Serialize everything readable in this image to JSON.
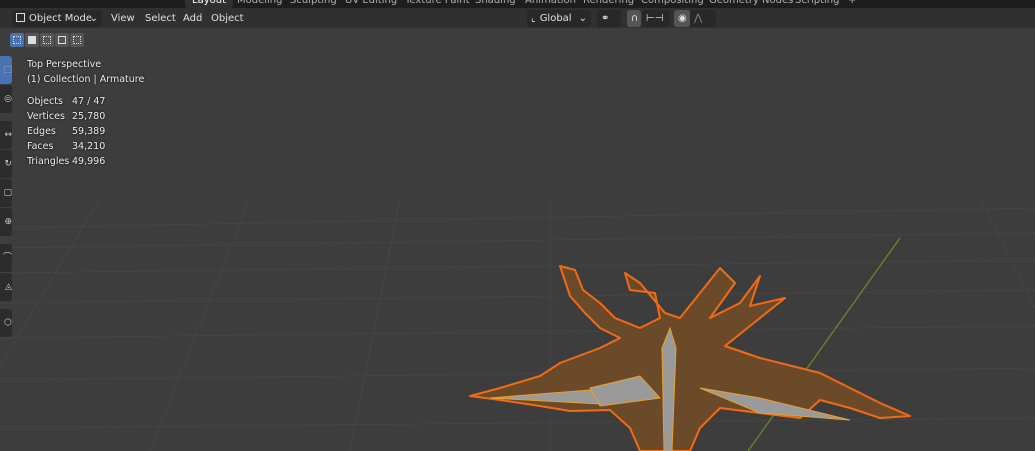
{
  "workspace_tabs": [
    "Layout",
    "Modeling",
    "Sculpting",
    "UV Editing",
    "Texture Paint",
    "Shading",
    "Animation",
    "Rendering",
    "Compositing",
    "Geometry Nodes",
    "Scripting",
    "+"
  ],
  "active_tab": "Layout",
  "header": {
    "mode": "Object Mode",
    "menus": [
      "View",
      "Select",
      "Add",
      "Object"
    ],
    "orientation": "Global"
  },
  "overlay": {
    "view": "Top Perspective",
    "collection": "(1) Collection | Armature",
    "stats": [
      {
        "label": "Objects",
        "value": "47 / 47"
      },
      {
        "label": "Vertices",
        "value": "25,780"
      },
      {
        "label": "Edges",
        "value": "59,389"
      },
      {
        "label": "Faces",
        "value": "34,210"
      },
      {
        "label": "Triangles",
        "value": "49,996"
      }
    ]
  },
  "colors": {
    "accent": "#4772b3",
    "selection": "#f36a16",
    "y_axis": "#6b8e23"
  }
}
